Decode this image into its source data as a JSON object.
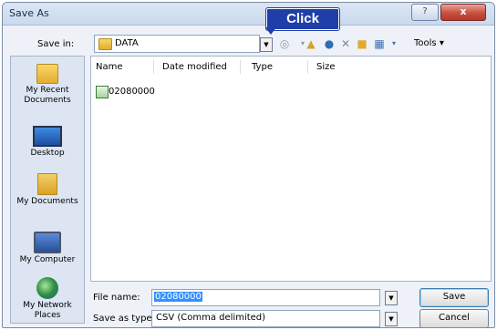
{
  "window": {
    "title": "Save As",
    "help_label": "?",
    "close_label": "x"
  },
  "annotation": {
    "label": "Click"
  },
  "save_in": {
    "label": "Save in:",
    "value": "DATA"
  },
  "toolbar": {
    "tools_label": "Tools"
  },
  "places": [
    {
      "label": "My Recent Documents"
    },
    {
      "label": "Desktop"
    },
    {
      "label": "My Documents"
    },
    {
      "label": "My Computer"
    },
    {
      "label": "My Network Places"
    }
  ],
  "columns": [
    "Name",
    "Date modified",
    "Type",
    "Size"
  ],
  "files": [
    {
      "name": "02080000"
    }
  ],
  "file_name": {
    "label": "File name:",
    "value": "02080000"
  },
  "save_type": {
    "label": "Save as type:",
    "value": "CSV (Comma delimited)"
  },
  "buttons": {
    "save": "Save",
    "cancel": "Cancel"
  }
}
